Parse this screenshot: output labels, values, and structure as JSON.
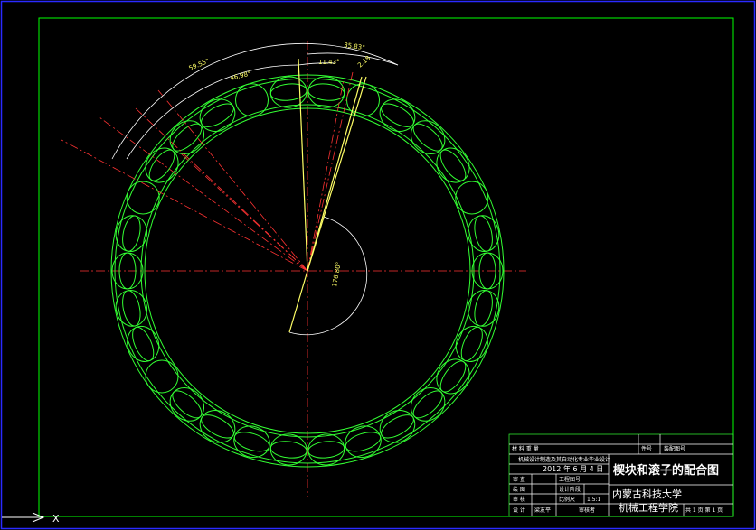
{
  "colors": {
    "background": "#000000",
    "outer_frame": "#2a2aff",
    "inner_frame": "#00ff00",
    "rollers": "#33ff33",
    "centerlines": "#ff3333",
    "dimensions": "#ffff66",
    "text": "#ffffff"
  },
  "dimensions": {
    "angle_outer_left": "59.55°",
    "angle_inner_left": "46.98°",
    "angle_mid": "11.43°",
    "angle_right": "35.83°",
    "angle_small": "2.18",
    "angle_big": "176.80°"
  },
  "title_block": {
    "material_label": "材 料 重 量",
    "part_no_label": "件号",
    "drawing_no_label": "装配图号",
    "course_line": "机械设计制造及其自动化专业毕业设计",
    "date": "2012 年 6 月 4 日",
    "title": "楔块和滚子的配合图",
    "row_labels": [
      "审 查",
      "绘 图",
      "审 核",
      "设 计"
    ],
    "cells": [
      "工程图号",
      "设计阶段",
      "比例尺",
      "1.5:1"
    ],
    "designer": "梁友平",
    "checker": "审核者",
    "university": "内蒙古科技大学",
    "college": "机械工程学院",
    "sheet": "共 1 页 第 1 页"
  },
  "ucs_icon_label": "X"
}
